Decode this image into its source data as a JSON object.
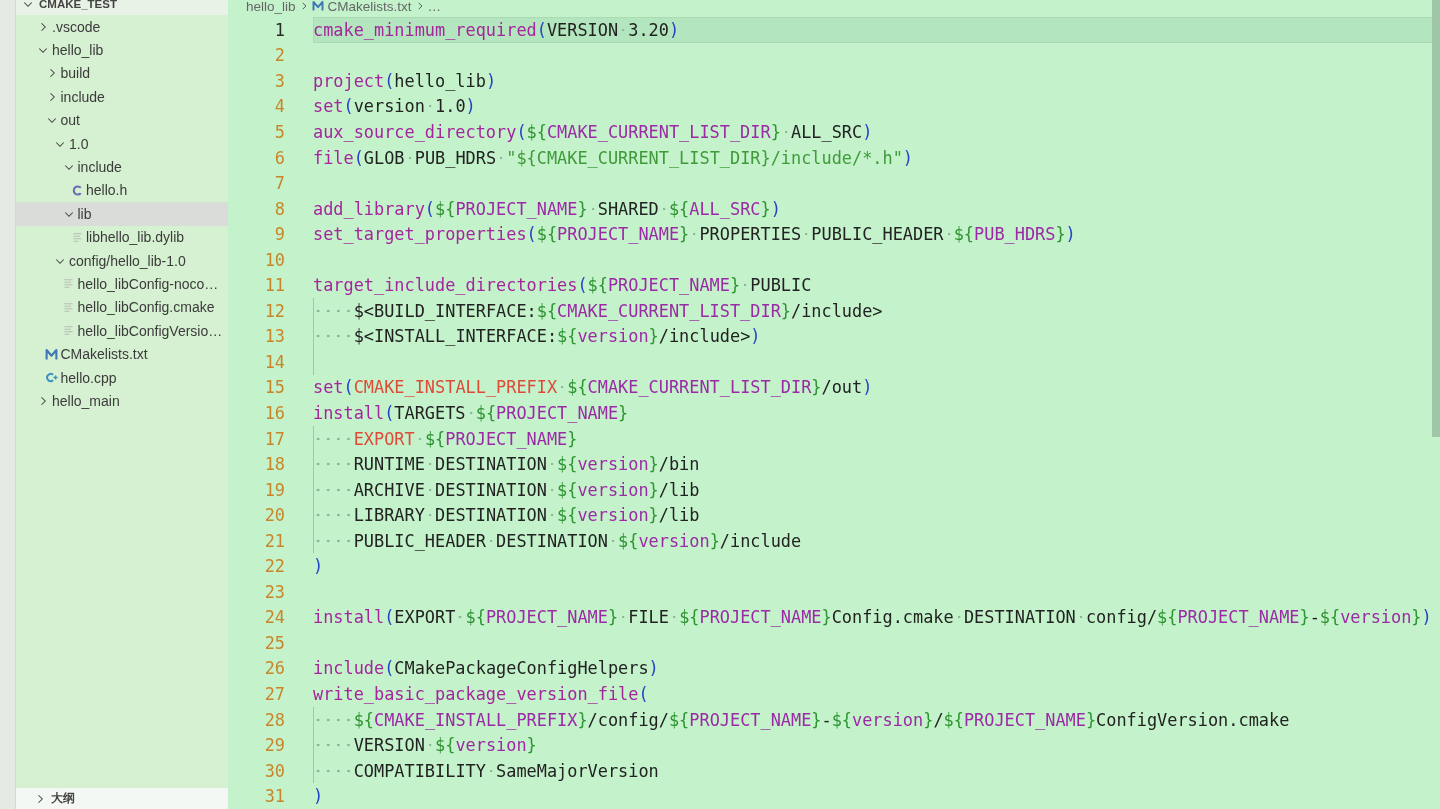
{
  "explorer": {
    "title": "CMAKE_TEST",
    "expanded": true,
    "items": [
      {
        "kind": "folder",
        "label": ".vscode",
        "expanded": false,
        "selected": false
      },
      {
        "kind": "folder",
        "label": "hello_lib",
        "expanded": true,
        "selected": false,
        "children": [
          {
            "kind": "folder",
            "label": "build",
            "expanded": false,
            "selected": false
          },
          {
            "kind": "folder",
            "label": "include",
            "expanded": false,
            "selected": false
          },
          {
            "kind": "folder",
            "label": "out",
            "expanded": true,
            "selected": false,
            "children": [
              {
                "kind": "folder",
                "label": "1.0",
                "expanded": true,
                "selected": false,
                "children": [
                  {
                    "kind": "folder",
                    "label": "include",
                    "expanded": true,
                    "selected": false,
                    "children": [
                      {
                        "kind": "c-file",
                        "label": "hello.h",
                        "selected": false
                      }
                    ]
                  },
                  {
                    "kind": "folder",
                    "label": "lib",
                    "expanded": true,
                    "selected": true,
                    "children": [
                      {
                        "kind": "text-file",
                        "label": "libhello_lib.dylib",
                        "selected": false
                      }
                    ]
                  }
                ]
              },
              {
                "kind": "folder",
                "label": "config/hello_lib-1.0",
                "expanded": true,
                "selected": false,
                "children": [
                  {
                    "kind": "text-file",
                    "label": "hello_libConfig-noco…",
                    "selected": false
                  },
                  {
                    "kind": "text-file",
                    "label": "hello_libConfig.cmake",
                    "selected": false
                  },
                  {
                    "kind": "text-file",
                    "label": "hello_libConfigVersio…",
                    "selected": false
                  }
                ]
              }
            ]
          },
          {
            "kind": "cmake-file",
            "label": "CMakelists.txt",
            "selected": false
          },
          {
            "kind": "cpp-file",
            "label": "hello.cpp",
            "selected": false
          }
        ]
      },
      {
        "kind": "folder",
        "label": "hello_main",
        "expanded": false,
        "selected": false
      }
    ]
  },
  "outline": {
    "title": "大纲",
    "expanded": false
  },
  "breadcrumb": [
    {
      "kind": "folder",
      "label": "hello_lib"
    },
    {
      "kind": "cmake-file",
      "label": "CMakelists.txt"
    },
    {
      "kind": "more",
      "label": "…"
    }
  ],
  "editor": {
    "lines": [
      {
        "number": "1",
        "current": true,
        "indent_guide": false,
        "tokens": [
          {
            "kind": "cmd",
            "text": "cmake_minimum_required"
          },
          {
            "kind": "paren",
            "text": "("
          },
          {
            "kind": "text",
            "text": "VERSION 3.20"
          },
          {
            "kind": "paren",
            "text": ")"
          }
        ]
      },
      {
        "number": "2",
        "current": false,
        "indent_guide": false
      },
      {
        "number": "3",
        "current": false,
        "indent_guide": false,
        "tokens": [
          {
            "kind": "cmd",
            "text": "project"
          },
          {
            "kind": "paren",
            "text": "("
          },
          {
            "kind": "text",
            "text": "hello_lib"
          },
          {
            "kind": "paren",
            "text": ")"
          }
        ]
      },
      {
        "number": "4",
        "current": false,
        "indent_guide": false,
        "tokens": [
          {
            "kind": "cmd",
            "text": "set"
          },
          {
            "kind": "paren",
            "text": "("
          },
          {
            "kind": "text",
            "text": "version 1.0"
          },
          {
            "kind": "paren",
            "text": ")"
          }
        ]
      },
      {
        "number": "5",
        "current": false,
        "indent_guide": false,
        "tokens": [
          {
            "kind": "cmd",
            "text": "aux_source_directory"
          },
          {
            "kind": "paren",
            "text": "("
          },
          {
            "kind": "brace",
            "text": "${"
          },
          {
            "kind": "var",
            "text": "CMAKE_CURRENT_LIST_DIR"
          },
          {
            "kind": "brace",
            "text": "}"
          },
          {
            "kind": "text",
            "text": " ALL_SRC"
          },
          {
            "kind": "paren",
            "text": ")"
          }
        ]
      },
      {
        "number": "6",
        "current": false,
        "indent_guide": false,
        "tokens": [
          {
            "kind": "cmd",
            "text": "file"
          },
          {
            "kind": "paren",
            "text": "("
          },
          {
            "kind": "text",
            "text": "GLOB PUB_HDRS "
          },
          {
            "kind": "str",
            "text": "\"${CMAKE_CURRENT_LIST_DIR}/include/*.h\""
          },
          {
            "kind": "paren",
            "text": ")"
          }
        ]
      },
      {
        "number": "7",
        "current": false,
        "indent_guide": false
      },
      {
        "number": "8",
        "current": false,
        "indent_guide": false,
        "tokens": [
          {
            "kind": "cmd",
            "text": "add_library"
          },
          {
            "kind": "paren",
            "text": "("
          },
          {
            "kind": "brace",
            "text": "${"
          },
          {
            "kind": "var",
            "text": "PROJECT_NAME"
          },
          {
            "kind": "brace",
            "text": "}"
          },
          {
            "kind": "text",
            "text": " SHARED "
          },
          {
            "kind": "brace",
            "text": "${"
          },
          {
            "kind": "var",
            "text": "ALL_SRC"
          },
          {
            "kind": "brace",
            "text": "}"
          },
          {
            "kind": "paren",
            "text": ")"
          }
        ]
      },
      {
        "number": "9",
        "current": false,
        "indent_guide": false,
        "tokens": [
          {
            "kind": "cmd",
            "text": "set_target_properties"
          },
          {
            "kind": "paren",
            "text": "("
          },
          {
            "kind": "brace",
            "text": "${"
          },
          {
            "kind": "var",
            "text": "PROJECT_NAME"
          },
          {
            "kind": "brace",
            "text": "}"
          },
          {
            "kind": "text",
            "text": " PROPERTIES PUBLIC_HEADER "
          },
          {
            "kind": "brace",
            "text": "${"
          },
          {
            "kind": "var",
            "text": "PUB_HDRS"
          },
          {
            "kind": "brace",
            "text": "}"
          },
          {
            "kind": "paren",
            "text": ")"
          }
        ]
      },
      {
        "number": "10",
        "current": false,
        "indent_guide": false
      },
      {
        "number": "11",
        "current": false,
        "indent_guide": false,
        "tokens": [
          {
            "kind": "cmd",
            "text": "target_include_directories"
          },
          {
            "kind": "paren",
            "text": "("
          },
          {
            "kind": "brace",
            "text": "${"
          },
          {
            "kind": "var",
            "text": "PROJECT_NAME"
          },
          {
            "kind": "brace",
            "text": "}"
          },
          {
            "kind": "text",
            "text": " PUBLIC"
          }
        ]
      },
      {
        "number": "12",
        "current": false,
        "indent_guide": true,
        "tokens": [
          {
            "kind": "text",
            "text": "    $<BUILD_INTERFACE:"
          },
          {
            "kind": "brace",
            "text": "${"
          },
          {
            "kind": "var",
            "text": "CMAKE_CURRENT_LIST_DIR"
          },
          {
            "kind": "brace",
            "text": "}"
          },
          {
            "kind": "text",
            "text": "/include>"
          }
        ]
      },
      {
        "number": "13",
        "current": false,
        "indent_guide": true,
        "tokens": [
          {
            "kind": "text",
            "text": "    $<INSTALL_INTERFACE:"
          },
          {
            "kind": "brace",
            "text": "${"
          },
          {
            "kind": "var",
            "text": "version"
          },
          {
            "kind": "brace",
            "text": "}"
          },
          {
            "kind": "text",
            "text": "/include>"
          },
          {
            "kind": "paren",
            "text": ")"
          }
        ]
      },
      {
        "number": "14",
        "current": false,
        "indent_guide": true
      },
      {
        "number": "15",
        "current": false,
        "indent_guide": false,
        "tokens": [
          {
            "kind": "cmd",
            "text": "set"
          },
          {
            "kind": "paren",
            "text": "("
          },
          {
            "kind": "builtin",
            "text": "CMAKE_INSTALL_PREFIX"
          },
          {
            "kind": "brace",
            "text": " ${"
          },
          {
            "kind": "var",
            "text": "CMAKE_CURRENT_LIST_DIR"
          },
          {
            "kind": "brace",
            "text": "}"
          },
          {
            "kind": "text",
            "text": "/out"
          },
          {
            "kind": "paren",
            "text": ")"
          }
        ]
      },
      {
        "number": "16",
        "current": false,
        "indent_guide": false,
        "tokens": [
          {
            "kind": "cmd",
            "text": "install"
          },
          {
            "kind": "paren",
            "text": "("
          },
          {
            "kind": "text",
            "text": "TARGETS "
          },
          {
            "kind": "brace",
            "text": "${"
          },
          {
            "kind": "var",
            "text": "PROJECT_NAME"
          },
          {
            "kind": "brace",
            "text": "}"
          }
        ]
      },
      {
        "number": "17",
        "current": false,
        "indent_guide": true,
        "tokens": [
          {
            "kind": "builtin",
            "text": "    EXPORT "
          },
          {
            "kind": "brace",
            "text": "${"
          },
          {
            "kind": "var",
            "text": "PROJECT_NAME"
          },
          {
            "kind": "brace",
            "text": "}"
          }
        ]
      },
      {
        "number": "18",
        "current": false,
        "indent_guide": true,
        "tokens": [
          {
            "kind": "text",
            "text": "    RUNTIME DESTINATION "
          },
          {
            "kind": "brace",
            "text": "${"
          },
          {
            "kind": "var",
            "text": "version"
          },
          {
            "kind": "brace",
            "text": "}"
          },
          {
            "kind": "text",
            "text": "/bin"
          }
        ]
      },
      {
        "number": "19",
        "current": false,
        "indent_guide": true,
        "tokens": [
          {
            "kind": "text",
            "text": "    ARCHIVE DESTINATION "
          },
          {
            "kind": "brace",
            "text": "${"
          },
          {
            "kind": "var",
            "text": "version"
          },
          {
            "kind": "brace",
            "text": "}"
          },
          {
            "kind": "text",
            "text": "/lib"
          }
        ]
      },
      {
        "number": "20",
        "current": false,
        "indent_guide": true,
        "tokens": [
          {
            "kind": "text",
            "text": "    LIBRARY DESTINATION "
          },
          {
            "kind": "brace",
            "text": "${"
          },
          {
            "kind": "var",
            "text": "version"
          },
          {
            "kind": "brace",
            "text": "}"
          },
          {
            "kind": "text",
            "text": "/lib"
          }
        ]
      },
      {
        "number": "21",
        "current": false,
        "indent_guide": true,
        "tokens": [
          {
            "kind": "text",
            "text": "    PUBLIC_HEADER DESTINATION "
          },
          {
            "kind": "brace",
            "text": "${"
          },
          {
            "kind": "var",
            "text": "version"
          },
          {
            "kind": "brace",
            "text": "}"
          },
          {
            "kind": "text",
            "text": "/include"
          }
        ]
      },
      {
        "number": "22",
        "current": false,
        "indent_guide": false,
        "tokens": [
          {
            "kind": "paren",
            "text": ")"
          }
        ]
      },
      {
        "number": "23",
        "current": false,
        "indent_guide": false
      },
      {
        "number": "24",
        "current": false,
        "indent_guide": false,
        "tokens": [
          {
            "kind": "cmd",
            "text": "install"
          },
          {
            "kind": "paren",
            "text": "("
          },
          {
            "kind": "text",
            "text": "EXPORT "
          },
          {
            "kind": "brace",
            "text": "${"
          },
          {
            "kind": "var",
            "text": "PROJECT_NAME"
          },
          {
            "kind": "brace",
            "text": "}"
          },
          {
            "kind": "text",
            "text": " FILE "
          },
          {
            "kind": "brace",
            "text": "${"
          },
          {
            "kind": "var",
            "text": "PROJECT_NAME"
          },
          {
            "kind": "brace",
            "text": "}"
          },
          {
            "kind": "text",
            "text": "Config.cmake DESTINATION config/"
          },
          {
            "kind": "brace",
            "text": "${"
          },
          {
            "kind": "var",
            "text": "PROJECT_NAME"
          },
          {
            "kind": "brace",
            "text": "}"
          },
          {
            "kind": "text",
            "text": "-"
          },
          {
            "kind": "brace",
            "text": "${"
          },
          {
            "kind": "var",
            "text": "version"
          },
          {
            "kind": "brace",
            "text": "}"
          },
          {
            "kind": "paren",
            "text": ")"
          }
        ]
      },
      {
        "number": "25",
        "current": false,
        "indent_guide": false
      },
      {
        "number": "26",
        "current": false,
        "indent_guide": false,
        "tokens": [
          {
            "kind": "cmd",
            "text": "include"
          },
          {
            "kind": "paren",
            "text": "("
          },
          {
            "kind": "text",
            "text": "CMakePackageConfigHelpers"
          },
          {
            "kind": "paren",
            "text": ")"
          }
        ]
      },
      {
        "number": "27",
        "current": false,
        "indent_guide": false,
        "tokens": [
          {
            "kind": "cmd",
            "text": "write_basic_package_version_file"
          },
          {
            "kind": "paren",
            "text": "("
          }
        ]
      },
      {
        "number": "28",
        "current": false,
        "indent_guide": true,
        "tokens": [
          {
            "kind": "brace",
            "text": "    ${"
          },
          {
            "kind": "var",
            "text": "CMAKE_INSTALL_PREFIX"
          },
          {
            "kind": "brace",
            "text": "}"
          },
          {
            "kind": "text",
            "text": "/config/"
          },
          {
            "kind": "brace",
            "text": "${"
          },
          {
            "kind": "var",
            "text": "PROJECT_NAME"
          },
          {
            "kind": "brace",
            "text": "}"
          },
          {
            "kind": "text",
            "text": "-"
          },
          {
            "kind": "brace",
            "text": "${"
          },
          {
            "kind": "var",
            "text": "version"
          },
          {
            "kind": "brace",
            "text": "}"
          },
          {
            "kind": "text",
            "text": "/"
          },
          {
            "kind": "brace",
            "text": "${"
          },
          {
            "kind": "var",
            "text": "PROJECT_NAME"
          },
          {
            "kind": "brace",
            "text": "}"
          },
          {
            "kind": "text",
            "text": "ConfigVersion.cmake"
          }
        ]
      },
      {
        "number": "29",
        "current": false,
        "indent_guide": true,
        "tokens": [
          {
            "kind": "text",
            "text": "    VERSION "
          },
          {
            "kind": "brace",
            "text": "${"
          },
          {
            "kind": "var",
            "text": "version"
          },
          {
            "kind": "brace",
            "text": "}"
          }
        ]
      },
      {
        "number": "30",
        "current": false,
        "indent_guide": true,
        "tokens": [
          {
            "kind": "text",
            "text": "    COMPATIBILITY SameMajorVersion"
          }
        ]
      },
      {
        "number": "31",
        "current": false,
        "indent_guide": false,
        "tokens": [
          {
            "kind": "paren",
            "text": ")"
          }
        ]
      }
    ]
  }
}
